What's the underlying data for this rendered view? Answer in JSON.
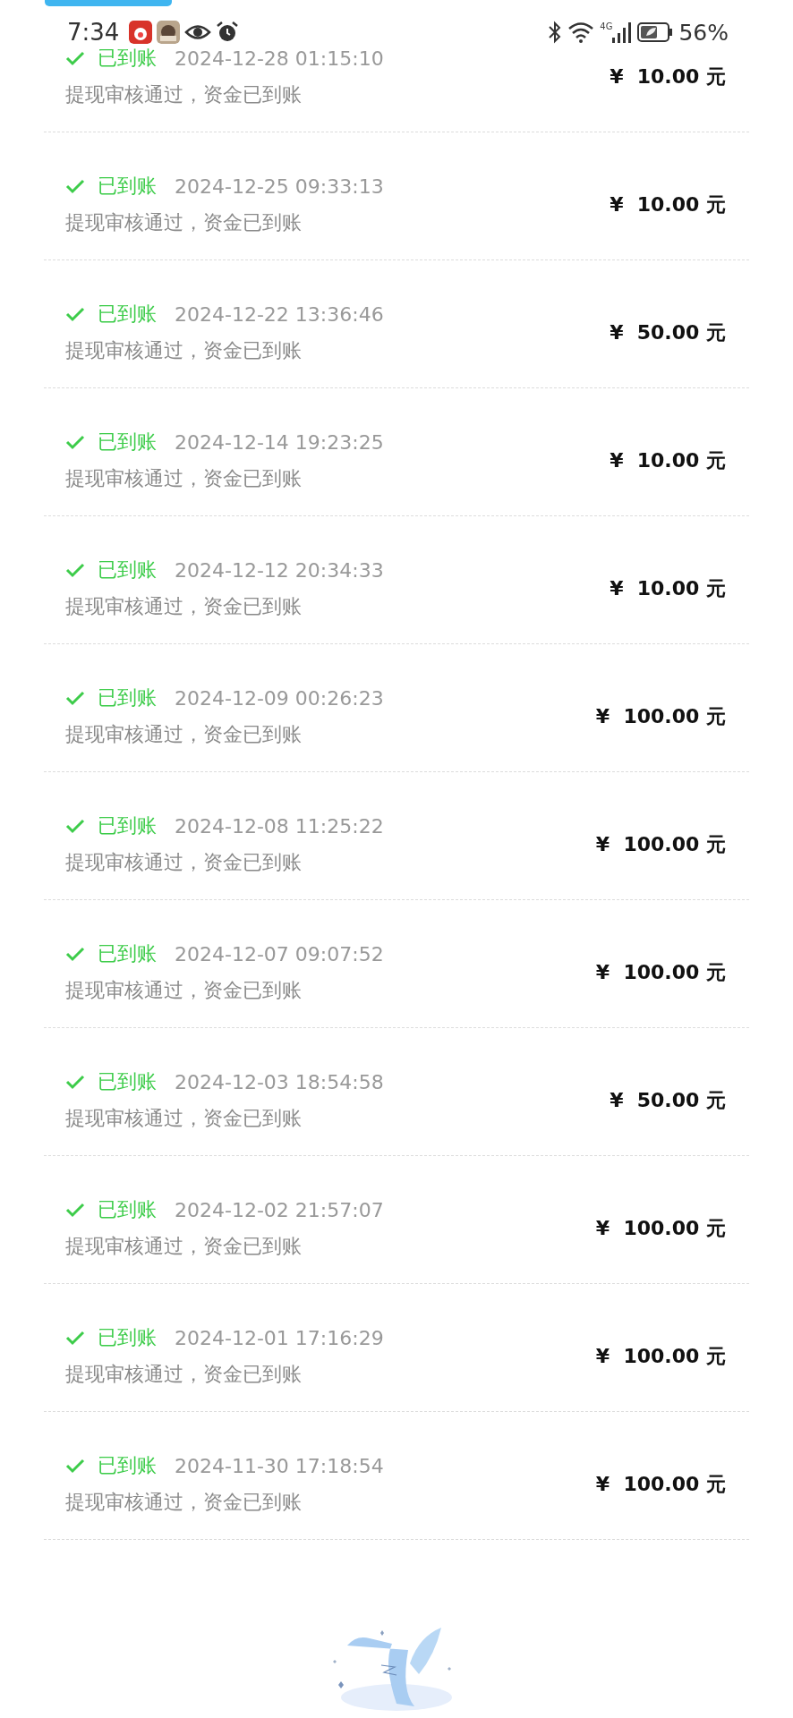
{
  "status_bar": {
    "time": "7:34",
    "network": "4G",
    "battery": "56%"
  },
  "records": [
    {
      "status": "已到账",
      "time": "2024-12-28 01:15:10",
      "note": "提现审核通过，资金已到账",
      "amount": "¥  10.00 元"
    },
    {
      "status": "已到账",
      "time": "2024-12-25 09:33:13",
      "note": "提现审核通过，资金已到账",
      "amount": "¥  10.00 元"
    },
    {
      "status": "已到账",
      "time": "2024-12-22 13:36:46",
      "note": "提现审核通过，资金已到账",
      "amount": "¥  50.00 元"
    },
    {
      "status": "已到账",
      "time": "2024-12-14 19:23:25",
      "note": "提现审核通过，资金已到账",
      "amount": "¥  10.00 元"
    },
    {
      "status": "已到账",
      "time": "2024-12-12 20:34:33",
      "note": "提现审核通过，资金已到账",
      "amount": "¥  10.00 元"
    },
    {
      "status": "已到账",
      "time": "2024-12-09 00:26:23",
      "note": "提现审核通过，资金已到账",
      "amount": "¥  100.00 元"
    },
    {
      "status": "已到账",
      "time": "2024-12-08 11:25:22",
      "note": "提现审核通过，资金已到账",
      "amount": "¥  100.00 元"
    },
    {
      "status": "已到账",
      "time": "2024-12-07 09:07:52",
      "note": "提现审核通过，资金已到账",
      "amount": "¥  100.00 元"
    },
    {
      "status": "已到账",
      "time": "2024-12-03 18:54:58",
      "note": "提现审核通过，资金已到账",
      "amount": "¥  50.00 元"
    },
    {
      "status": "已到账",
      "time": "2024-12-02 21:57:07",
      "note": "提现审核通过，资金已到账",
      "amount": "¥  100.00 元"
    },
    {
      "status": "已到账",
      "time": "2024-12-01 17:16:29",
      "note": "提现审核通过，资金已到账",
      "amount": "¥  100.00 元"
    },
    {
      "status": "已到账",
      "time": "2024-11-30 17:18:54",
      "note": "提现审核通过，资金已到账",
      "amount": "¥  100.00 元"
    }
  ]
}
